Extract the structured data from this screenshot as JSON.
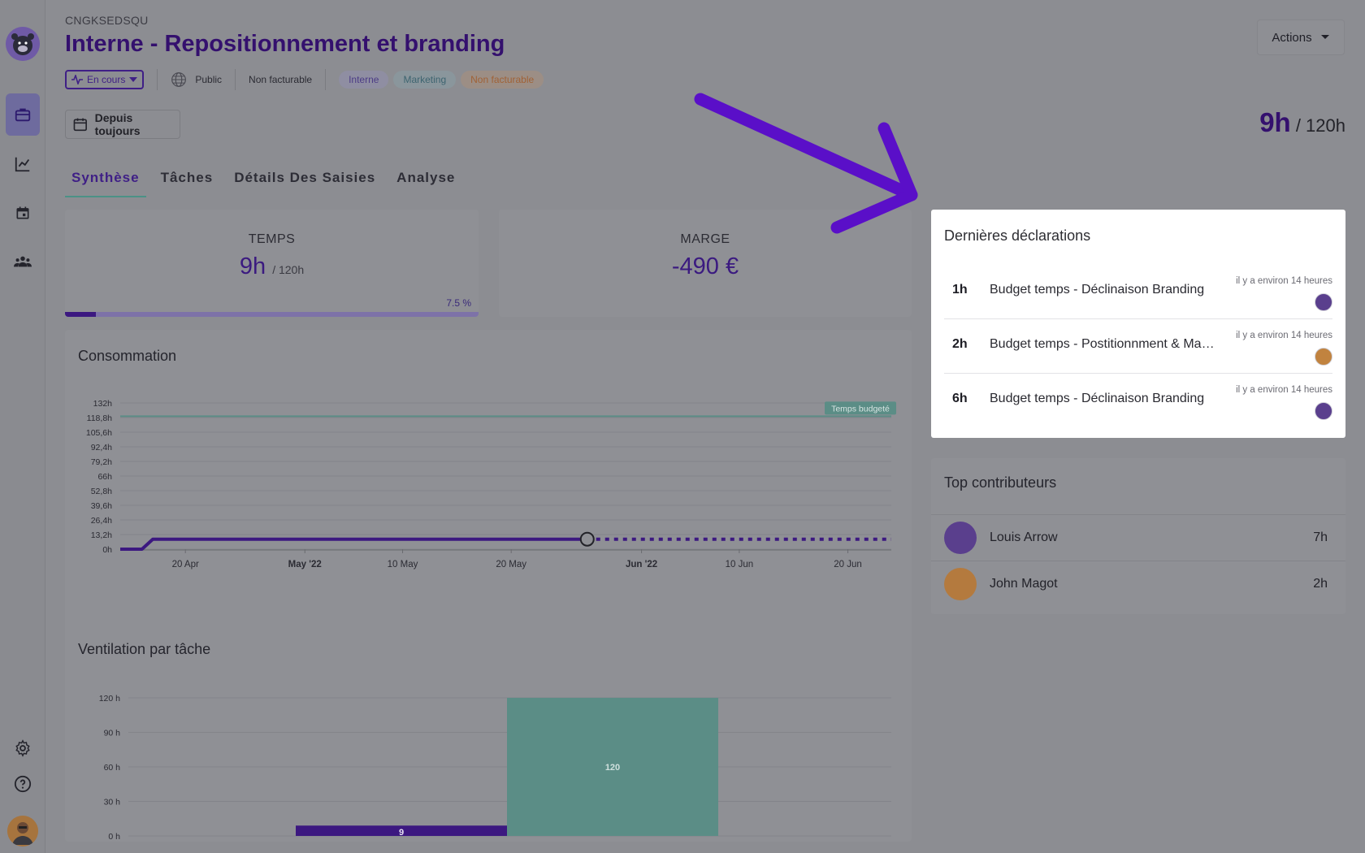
{
  "project": {
    "code": "CNGKSEDSQU",
    "title": "Interne - Repositionnement et branding",
    "status": "En cours",
    "visibility": "Public",
    "billing": "Non facturable",
    "tags": [
      "Interne",
      "Marketing",
      "Non facturable"
    ]
  },
  "actions_label": "Actions",
  "date_filter": "Depuis toujours",
  "total": {
    "used": "9h",
    "budget": "/ 120h"
  },
  "tabs": [
    "Synthèse",
    "Tâches",
    "Détails Des Saisies",
    "Analyse"
  ],
  "active_tab": 0,
  "temps_card": {
    "label": "TEMPS",
    "value": "9h",
    "budget": "/ 120h",
    "percent_label": "7.5 %",
    "percent": 7.5
  },
  "marge_card": {
    "label": "MARGE",
    "value": "-490 €"
  },
  "consumption": {
    "title": "Consommation",
    "badge": "Temps budgeté"
  },
  "ventilation": {
    "title": "Ventilation par tâche"
  },
  "declarations": {
    "title": "Dernières déclarations",
    "items": [
      {
        "hours": "1h",
        "task": "Budget temps - Déclinaison Branding",
        "time": "il y a environ 14 heures"
      },
      {
        "hours": "2h",
        "task": "Budget temps - Postitionnment & Marketing",
        "time": "il y a environ 14 heures"
      },
      {
        "hours": "6h",
        "task": "Budget temps - Déclinaison Branding",
        "time": "il y a environ 14 heures"
      }
    ]
  },
  "contributors": {
    "title": "Top contributeurs",
    "items": [
      {
        "name": "Louis Arrow",
        "hours": "7h"
      },
      {
        "name": "John Magot",
        "hours": "2h"
      }
    ]
  },
  "colors": {
    "brand": "#3c1880",
    "accent": "#4b9286",
    "budget_bar": "#5b8d86",
    "arrow": "#5a0fc8"
  },
  "chart_data": [
    {
      "type": "line",
      "title": "Consommation",
      "x": [
        "14 Apr",
        "16 Apr",
        "17 Apr",
        "27 May",
        "24 Jun"
      ],
      "series": [
        {
          "values": [
            0,
            0,
            9,
            9,
            9
          ]
        }
      ],
      "xticks": [
        "20 Apr",
        "May '22",
        "10 May",
        "20 May",
        "Jun '22",
        "10 Jun",
        "20 Jun"
      ],
      "yticks": [
        "0h",
        "13,2h",
        "26,4h",
        "39,6h",
        "52,8h",
        "66h",
        "79,2h",
        "92,4h",
        "105,6h",
        "118,8h",
        "132h"
      ],
      "ylim": [
        0,
        132
      ],
      "budget_line": 120,
      "budget_label": "Temps budgeté"
    },
    {
      "type": "bar",
      "title": "Ventilation par tâche",
      "categories": [
        "",
        ""
      ],
      "values": [
        9,
        120
      ],
      "yticks": [
        "0 h",
        "30 h",
        "60 h",
        "90 h",
        "120 h"
      ],
      "ylim": [
        0,
        120
      ]
    }
  ]
}
